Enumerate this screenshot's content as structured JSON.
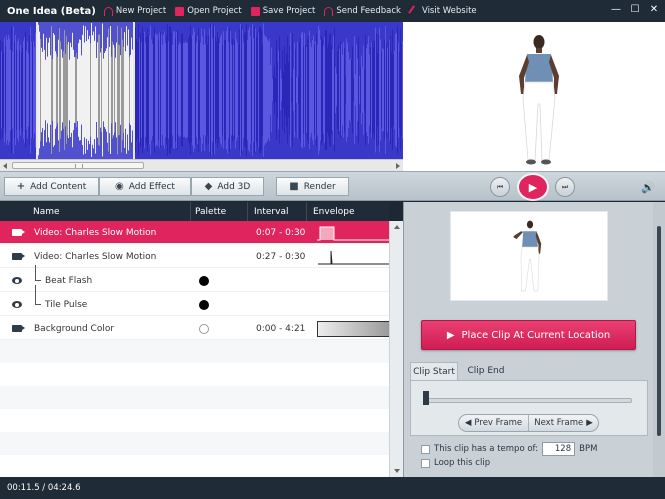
{
  "app": {
    "title": "One Idea (Beta)",
    "menu": [
      {
        "label": "New Project",
        "icon": "headset-icon"
      },
      {
        "label": "Open Project",
        "icon": "folder-icon"
      },
      {
        "label": "Save Project",
        "icon": "save-icon"
      },
      {
        "label": "Send Feedback",
        "icon": "headset-icon"
      },
      {
        "label": "Visit Website",
        "icon": "pen-icon"
      }
    ],
    "window_controls": {
      "minimize": "—",
      "maximize": "☐",
      "close": "✕"
    }
  },
  "toolbar": {
    "add_content": "Add Content",
    "add_effect": "Add Effect",
    "add_3d": "Add 3D",
    "render": "Render"
  },
  "transport": {
    "prev": "⏮",
    "play": "▶",
    "next": "⏭",
    "volume": "🔊"
  },
  "list": {
    "columns": [
      "Name",
      "Palette",
      "Interval",
      "Envelope"
    ],
    "rows": [
      {
        "name": "Video: Charles Slow Motion",
        "interval": "0:07 - 0:30",
        "icon": "video-camera-icon",
        "palette": "",
        "selected": true
      },
      {
        "name": "Video: Charles Slow Motion",
        "interval": "0:27 - 0:30",
        "icon": "video-camera-icon",
        "palette": "",
        "selected": false
      },
      {
        "name": "Beat Flash",
        "interval": "",
        "icon": "eye-icon",
        "palette": "black",
        "selected": false
      },
      {
        "name": "Tile Pulse",
        "interval": "",
        "icon": "eye-icon",
        "palette": "black",
        "selected": false
      },
      {
        "name": "Background Color",
        "interval": "0:00 - 4:21",
        "icon": "video-camera-icon",
        "palette": "white",
        "selected": false
      }
    ]
  },
  "clip_panel": {
    "place_button": "Place Clip At Current Location",
    "tabs": [
      "Clip Start",
      "Clip End"
    ],
    "prev_frame": "Prev Frame",
    "next_frame": "Next Frame",
    "tempo_label": "This clip has a tempo of:",
    "tempo_value": "128",
    "tempo_unit": "BPM",
    "loop_label": "Loop this clip"
  },
  "status": {
    "time": "00:11.5 / 04:24.6"
  },
  "colors": {
    "accent": "#e0245e",
    "waveform": "#3a38c8",
    "dark": "#1f2b36"
  }
}
